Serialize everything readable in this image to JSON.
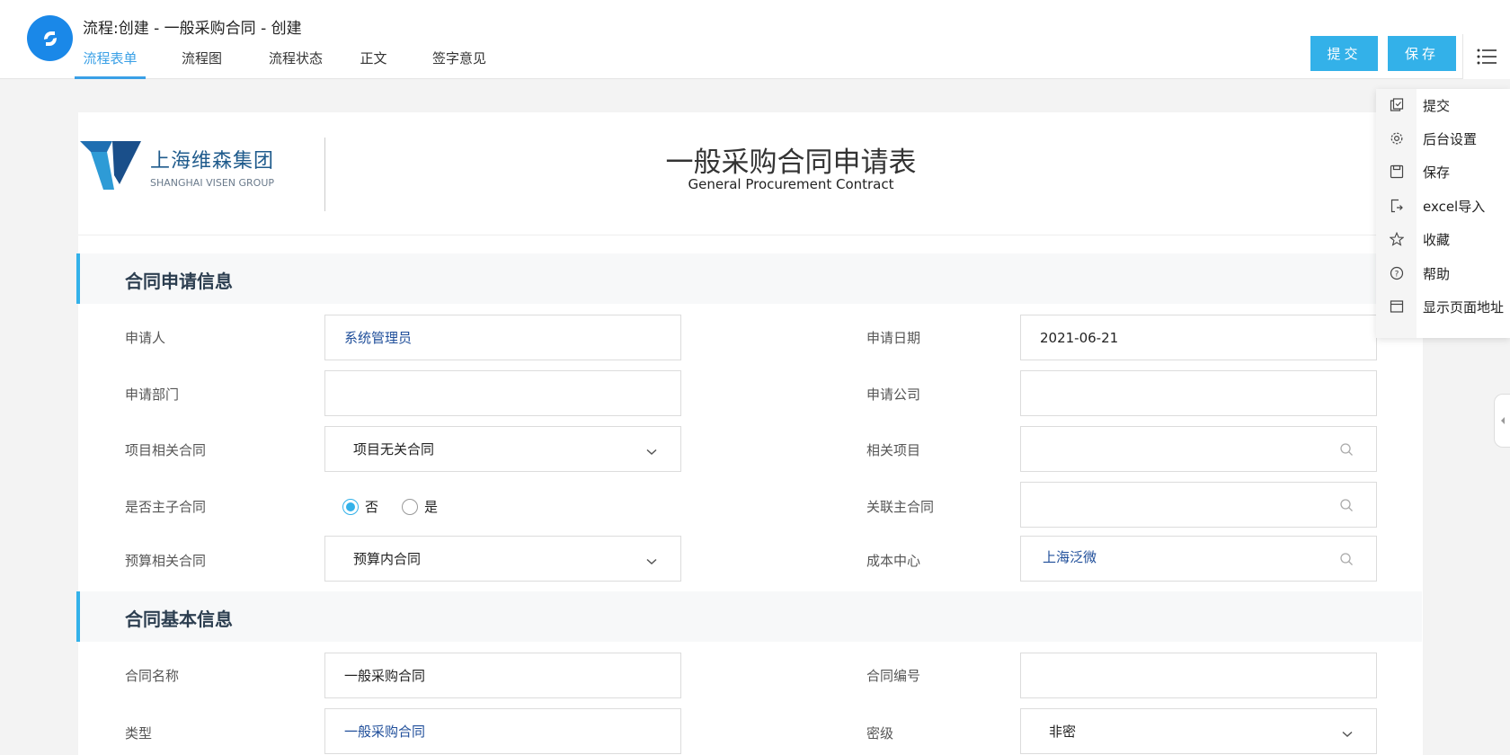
{
  "header": {
    "title": "流程:创建 - 一般采购合同 - 创建",
    "tabs": [
      {
        "label": "流程表单"
      },
      {
        "label": "流程图"
      },
      {
        "label": "流程状态"
      },
      {
        "label": "正文"
      },
      {
        "label": "签字意见"
      }
    ],
    "submit_label": "提交",
    "save_label": "保存"
  },
  "menu": {
    "items": [
      {
        "label": "提交",
        "icon": "submit-doc-icon"
      },
      {
        "label": "后台设置",
        "icon": "gear-icon"
      },
      {
        "label": "保存",
        "icon": "floppy-icon"
      },
      {
        "label": "excel导入",
        "icon": "import-icon"
      },
      {
        "label": "收藏",
        "icon": "star-icon"
      },
      {
        "label": "帮助",
        "icon": "help-icon"
      },
      {
        "label": "显示页面地址",
        "icon": "browser-window-icon"
      }
    ]
  },
  "form": {
    "company_cn": "上海维森集团",
    "company_en": "SHANGHAI VISEN GROUP",
    "title": "一般采购合同申请表",
    "subtitle": "General Procurement Contract",
    "section1": {
      "title": "合同申请信息",
      "applicant_label": "申请人",
      "applicant_value": "系统管理员",
      "date_label": "申请日期",
      "date_value": "2021-06-21",
      "dept_label": "申请部门",
      "dept_value": "",
      "company_label": "申请公司",
      "company_value": "",
      "project_contract_label": "项目相关合同",
      "project_contract_value": "项目无关合同",
      "related_project_label": "相关项目",
      "related_project_value": "",
      "is_master_label": "是否主子合同",
      "radio_no": "否",
      "radio_yes": "是",
      "radio_selected": "否",
      "master_contract_label": "关联主合同",
      "master_contract_value": "",
      "budget_label": "预算相关合同",
      "budget_value": "预算内合同",
      "cost_center_label": "成本中心",
      "cost_center_value": "上海泛微"
    },
    "section2": {
      "title": "合同基本信息",
      "name_label": "合同名称",
      "name_value": "一般采购合同",
      "number_label": "合同编号",
      "number_value": "",
      "type_label": "类型",
      "type_value": "一般采购合同",
      "secret_label": "密级",
      "secret_value": "非密"
    }
  },
  "colors": {
    "accent": "#33b1e9",
    "tab_active": "#3aa0e6",
    "link": "#1f4e9a",
    "logo_blue": "#1a88e8"
  }
}
